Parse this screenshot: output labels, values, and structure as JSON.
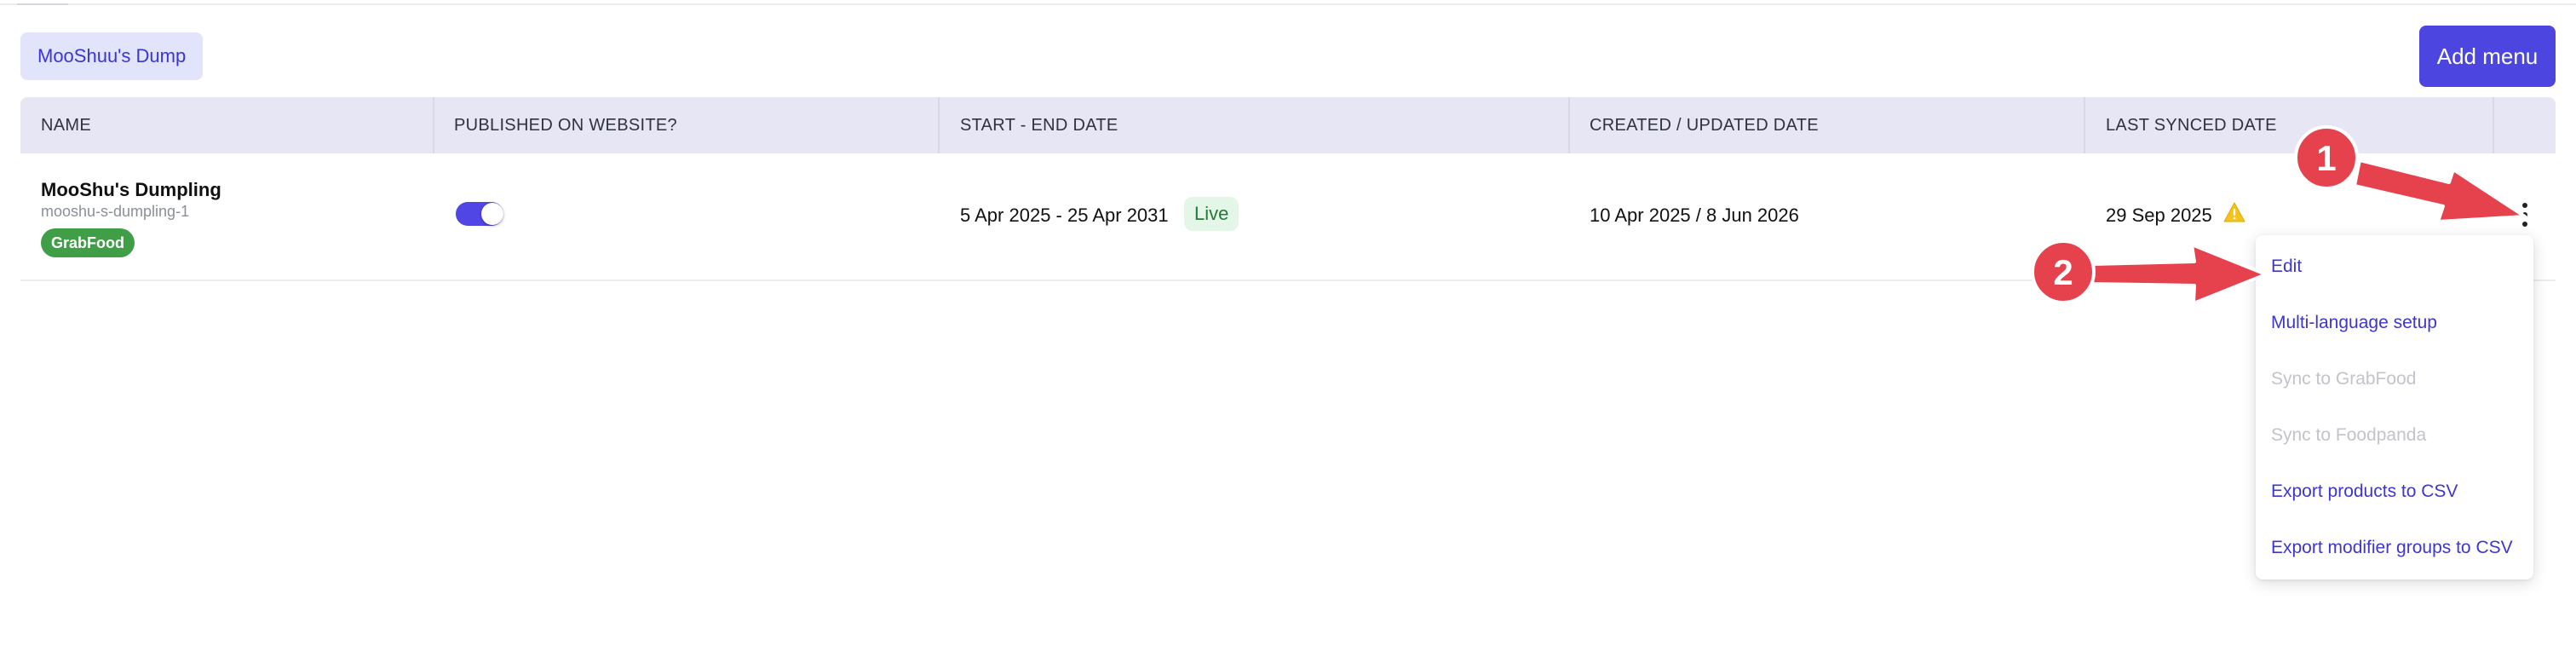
{
  "toolbar": {
    "menu_chip_label": "MooShuu's Dump",
    "add_menu_label": "Add menu"
  },
  "table": {
    "columns": [
      "NAME",
      "PUBLISHED ON WEBSITE?",
      "START - END DATE",
      "CREATED / UPDATED DATE",
      "LAST SYNCED DATE"
    ],
    "rows": [
      {
        "name": "MooShu's Dumpling",
        "slug": "mooshu-s-dumpling-1",
        "platform_badge": "GrabFood",
        "published": true,
        "date_range": "5 Apr 2025 - 25 Apr 2031",
        "status": "Live",
        "created_updated": "10 Apr 2025 / 8 Jun 2026",
        "last_synced": "29 Sep 2025"
      }
    ]
  },
  "dropdown": {
    "items": [
      {
        "label": "Edit",
        "enabled": true
      },
      {
        "label": "Multi-language setup",
        "enabled": true
      },
      {
        "label": "Sync to GrabFood",
        "enabled": false
      },
      {
        "label": "Sync to Foodpanda",
        "enabled": false
      },
      {
        "label": "Export products to CSV",
        "enabled": true
      },
      {
        "label": "Export modifier groups to CSV",
        "enabled": true
      }
    ]
  },
  "annotations": {
    "markers": [
      "1",
      "2"
    ]
  },
  "colors": {
    "accent": "#4c45e0",
    "header_bg": "#e6e6f4",
    "chip_bg": "#e1e4fb",
    "live_green": "#237a35",
    "badge_green": "#3f9e46",
    "warning": "#f4c21a",
    "annotation_red": "#e5424d",
    "disabled_text": "#c2c4cc"
  },
  "icons": {
    "warning": "warning-triangle-icon",
    "more": "kebab-menu-icon"
  }
}
